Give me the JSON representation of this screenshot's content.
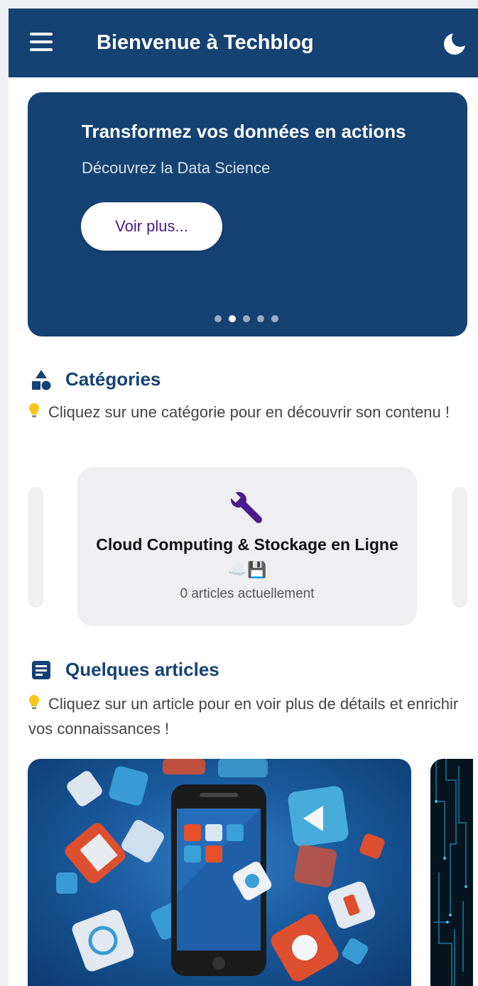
{
  "app_bar": {
    "title": "Bienvenue à Techblog",
    "menu_icon": "hamburger-menu-icon",
    "theme_icon": "moon-icon"
  },
  "hero": {
    "title": "Transformez vos données en actions",
    "subtitle": "Découvrez la Data Science",
    "button_label": "Voir plus...",
    "slides_count": 5,
    "active_slide": 2
  },
  "categories": {
    "icon": "shapes-icon",
    "title": "Catégories",
    "hint": "Cliquez sur une catégorie pour en découvrir son contenu !",
    "items": [
      {
        "icon": "wrench-icon",
        "title": "Cloud Computing & Stockage en Ligne",
        "emoji": "☁️💾",
        "count_text": "0 articles actuellement"
      }
    ]
  },
  "articles": {
    "icon": "article-icon",
    "title": "Quelques articles",
    "hint": "Cliquez sur un article pour en voir plus de détails et enrichir vos connaissances !"
  },
  "colors": {
    "primary": "#154273",
    "accent_text": "#4a1a8a",
    "icon_purple": "#4b1a8c",
    "card_bg": "#efeff2"
  }
}
